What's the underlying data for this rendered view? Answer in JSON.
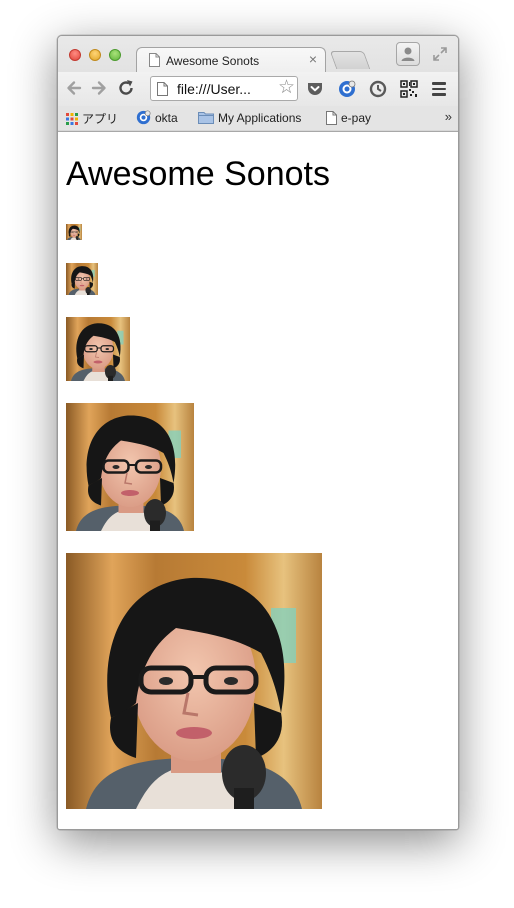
{
  "window": {
    "tab_title": "Awesome Sonots",
    "tab_close": "×"
  },
  "toolbar": {
    "back_icon": "arrow-left-icon",
    "forward_icon": "arrow-right-icon",
    "reload_icon": "reload-icon",
    "address": "file:///User...",
    "bookmark_star_icon": "star-icon",
    "extensions": [
      "pocket-icon",
      "okta-icon",
      "clock-icon",
      "qr-code-icon"
    ],
    "menu_icon": "hamburger-menu-icon"
  },
  "bookmarks": {
    "items": [
      {
        "label": "アプリ",
        "icon": "apps-grid-icon"
      },
      {
        "label": "okta",
        "icon": "okta-icon"
      },
      {
        "label": "My Applications",
        "icon": "folder-icon"
      },
      {
        "label": "e-pay",
        "icon": "page-icon"
      }
    ],
    "more": "»"
  },
  "page": {
    "heading": "Awesome Sonots",
    "images": [
      {
        "alt": "sonots",
        "size": "16px"
      },
      {
        "alt": "sonots",
        "size": "32px"
      },
      {
        "alt": "sonots",
        "size": "64px"
      },
      {
        "alt": "sonots",
        "size": "128px"
      },
      {
        "alt": "sonots",
        "size": "256px"
      }
    ]
  },
  "colors": {
    "tab_bg": "#f4f4f4",
    "chrome_bg": "#dedede",
    "okta_blue": "#2f6fd0",
    "photo_bg": "#c98a3a",
    "hair": "#1a1a1a",
    "skin": "#e8b49a"
  }
}
